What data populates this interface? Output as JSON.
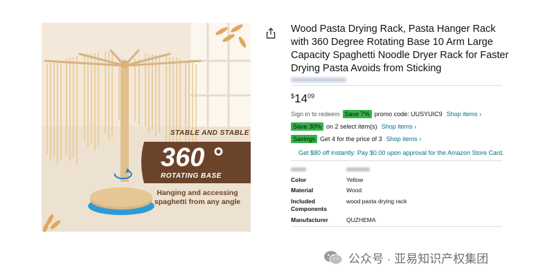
{
  "product_image": {
    "top_text": "STABLE AND STABLE",
    "big_text": "360 °",
    "sub_text": "ROTATING BASE",
    "caption_line1": "Hanging and accessing",
    "caption_line2": "spaghetti from any angle"
  },
  "title": "Wood Pasta Drying Rack, Pasta Hanger Rack with 360 Degree Rotating Base 10 Arm Large Capacity Spaghetti Noodle Dryer Rack for Faster Drying Pasta Avoids from Sticking",
  "price": {
    "symbol": "$",
    "whole": "14",
    "fraction": "09"
  },
  "promos": {
    "row1": {
      "prefix": "Sign in to redeem",
      "badge": "Save 7%",
      "text": "promo code: UUSYUIC9",
      "link": "Shop items ›"
    },
    "row2": {
      "badge": "Save 30%",
      "text": "on 2 select item(s)",
      "link": "Shop items ›"
    },
    "row3": {
      "badge": "Savings",
      "text": "Get 4 for the price of 3",
      "link": "Shop items ›"
    },
    "card_offer": "Get $80 off instantly: Pay $0.00 upon approval for the Amazon Store Card."
  },
  "specs": [
    {
      "label": "Color",
      "value": "Yellow"
    },
    {
      "label": "Material",
      "value": "Wood"
    },
    {
      "label": "Included Components",
      "value": "wood pasta drying rack"
    },
    {
      "label": "Manufacturer",
      "value": "QUZHEMA"
    }
  ],
  "watermark": {
    "text": "公众号 · 亚易知识产权集团"
  },
  "colors": {
    "badge_green": "#35b34a",
    "link_teal": "#007185",
    "image_banner_brown": "#6a432a",
    "image_background": "#f4e9dc"
  }
}
